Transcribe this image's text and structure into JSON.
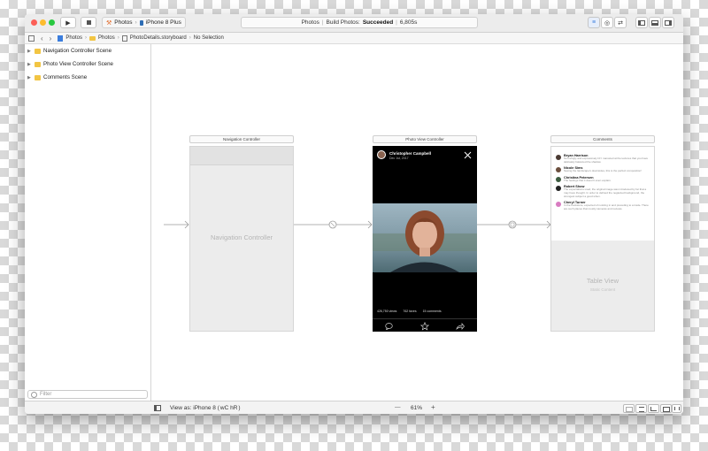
{
  "toolbar": {
    "scheme_app": "Photos",
    "scheme_device": "iPhone 8 Plus",
    "status_project": "Photos",
    "status_build": "Build Photos:",
    "status_result": "Succeeded",
    "status_time": "6,805s"
  },
  "jumpbar": {
    "items": [
      "Photos",
      "Photos",
      "PhotoDetails.storyboard",
      "No Selection"
    ]
  },
  "navigator": {
    "scenes": [
      "Navigation Controller Scene",
      "Photo View Controller Scene",
      "Comments Scene"
    ],
    "filter_placeholder": "Filter"
  },
  "canvas": {
    "nav": {
      "title": "Navigation Controller",
      "label": "Navigation Controller"
    },
    "photo": {
      "title": "Photo View Controller",
      "author": "Christopher Campbell",
      "date": "Dec 1st, 2017",
      "views": "426,750 views",
      "faves": "762 faves",
      "comments": "15 comments"
    },
    "comments": {
      "title": "Comments",
      "entries": [
        {
          "name": "Bryan Harrison",
          "text": "So lovingly and expressively lit! I marveled at the textures that you have delicately balanced the shadow."
        },
        {
          "name": "Nicole Sims",
          "text": "Seeing the landscape's downsides, this is the perfect composition!"
        },
        {
          "name": "Christina Petersen",
          "text": "The feelings that it doesn't even explain."
        },
        {
          "name": "Robert Show",
          "text": "The expectations used, the original image was introduced by far that a may have thought. In order to defined the neglected background, the strongest subject a good when."
        },
        {
          "name": "Cheryl Turner",
          "text": "In the bookstore, expected of noticing in and preceding to a trade. There are such places that mostly cameras and reviews."
        }
      ],
      "table_view_label": "Table View",
      "static_content_label": "Static Content"
    }
  },
  "bottombar": {
    "view_as": "View as: iPhone 8 (",
    "view_as_shortcut": "wC hR",
    "view_as_end": ")",
    "zoom_minus": "—",
    "zoom": "61%",
    "zoom_plus": "+"
  },
  "colors": {
    "accent": "#3b7ddd",
    "close": "#fc5f57",
    "minimize": "#fdbc2e",
    "zoom": "#28c840"
  }
}
